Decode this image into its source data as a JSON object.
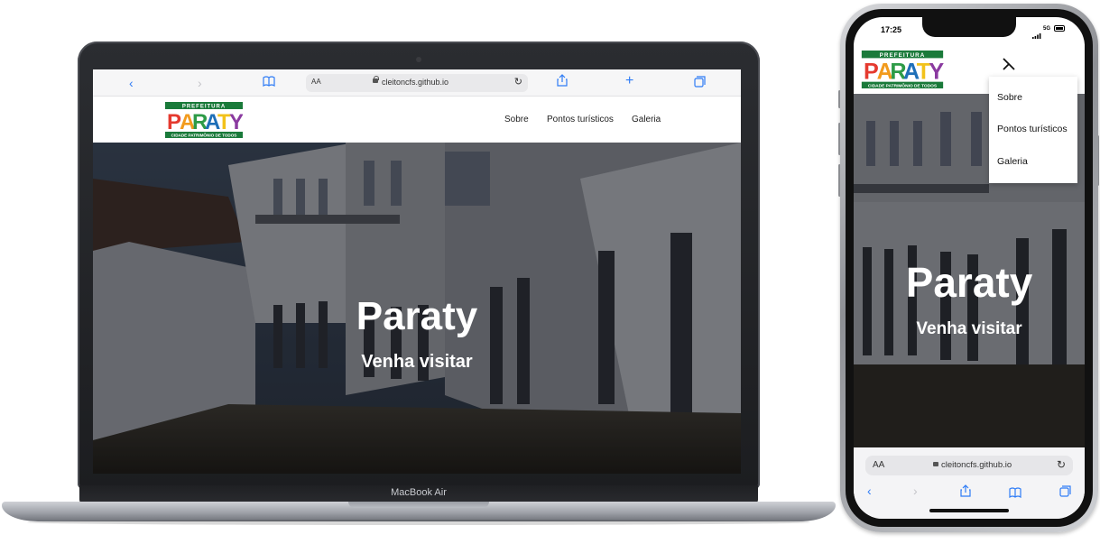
{
  "laptop": {
    "model_label": "MacBook Air",
    "browser": {
      "text_size_label": "AA",
      "url": "cleitoncfs.github.io",
      "icons": [
        "chevron-left-icon",
        "chevron-right-icon",
        "book-icon",
        "reload-icon",
        "share-icon",
        "plus-icon",
        "tabs-icon"
      ]
    },
    "site": {
      "logo": {
        "top": "PREFEITURA",
        "name": "PARATY",
        "tagline": "CIDADE PATRIMÔNIO DE TODOS"
      },
      "nav": [
        "Sobre",
        "Pontos turísticos",
        "Galeria"
      ],
      "hero_title": "Paraty",
      "hero_subtitle": "Venha visitar"
    }
  },
  "phone": {
    "status": {
      "time": "17:25",
      "network": "5G"
    },
    "site": {
      "logo": {
        "top": "PREFEITURA",
        "name": "PARATY",
        "tagline": "CIDADE PATRIMÔNIO DE TODOS"
      },
      "menu_items": [
        "Sobre",
        "Pontos turísticos",
        "Galeria"
      ],
      "hero_title": "Paraty",
      "hero_subtitle": "Venha visitar"
    },
    "browser": {
      "text_size_label": "AA",
      "url": "cleitoncfs.github.io"
    }
  },
  "colors": {
    "logo_green": "#1a7a3a",
    "logo_letters": [
      "#e53a2f",
      "#f29b1d",
      "#2d9b47",
      "#1e6fb8",
      "#f2c21b",
      "#8a3aa0"
    ],
    "safari_blue": "#2f7cf6"
  }
}
